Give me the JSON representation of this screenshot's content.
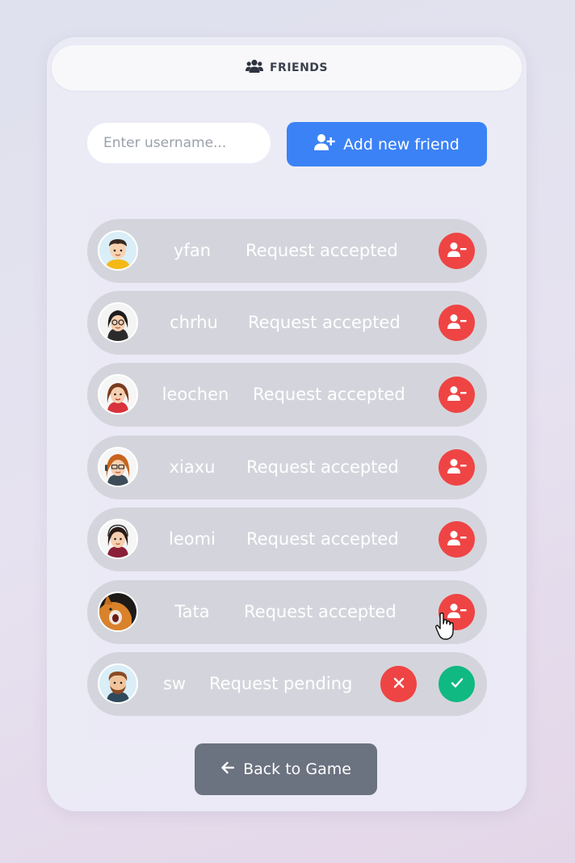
{
  "header": {
    "title": "FRIENDS",
    "icon": "users-icon"
  },
  "add_friend": {
    "placeholder": "Enter username...",
    "value": "",
    "button_label": "Add new friend",
    "button_icon": "user-plus-icon"
  },
  "friends": [
    {
      "username": "yfan",
      "status": "Request accepted",
      "action": "remove"
    },
    {
      "username": "chrhu",
      "status": "Request accepted",
      "action": "remove"
    },
    {
      "username": "leochen",
      "status": "Request accepted",
      "action": "remove"
    },
    {
      "username": "xiaxu",
      "status": "Request accepted",
      "action": "remove"
    },
    {
      "username": "leomi",
      "status": "Request accepted",
      "action": "remove"
    },
    {
      "username": "Tata",
      "status": "Request accepted",
      "action": "remove"
    },
    {
      "username": "sw",
      "status": "Request pending",
      "action": "pending"
    }
  ],
  "back_button": {
    "label": "Back to Game",
    "icon": "arrow-left-icon"
  },
  "colors": {
    "primary": "#3b82f6",
    "danger": "#ef4444",
    "success": "#10b981",
    "secondary": "#6b7280"
  }
}
